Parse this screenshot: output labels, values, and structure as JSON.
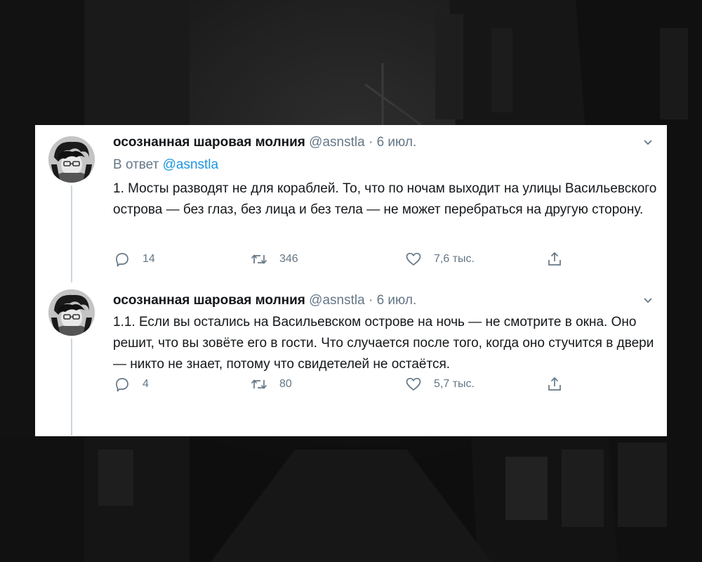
{
  "colors": {
    "name": "#14171a",
    "meta": "#657786",
    "link": "#1b95e0",
    "thread_line": "#ccd6dd"
  },
  "tweets": [
    {
      "author_name": "осознанная шаровая молния",
      "handle": "@asnstla",
      "separator": "·",
      "date": "6 июл.",
      "reply_prefix": "В ответ",
      "reply_mention": "@asnstla",
      "text": "1. Мосты разводят не для кораблей. То, что по ночам выходит на улицы Васильевского острова — без глаз, без лица и без тела — не может перебраться на другую сторону.",
      "replies": "14",
      "retweets": "346",
      "likes": "7,6 тыс.",
      "icons": {
        "caret": "chevron-down-icon",
        "reply": "reply-icon",
        "retweet": "retweet-icon",
        "like": "heart-icon",
        "share": "share-icon"
      }
    },
    {
      "author_name": "осознанная шаровая молния",
      "handle": "@asnstla",
      "separator": "·",
      "date": "6 июл.",
      "text": "1.1. Если вы остались на Васильевском острове на ночь — не смотрите в окна. Оно решит, что вы зовёте его в гости. Что случается после того, когда оно стучится в двери — никто не знает, потому что свидетелей не остаётся.",
      "replies": "4",
      "retweets": "80",
      "likes": "5,7 тыс.",
      "icons": {
        "caret": "chevron-down-icon",
        "reply": "reply-icon",
        "retweet": "retweet-icon",
        "like": "heart-icon",
        "share": "share-icon"
      }
    }
  ]
}
